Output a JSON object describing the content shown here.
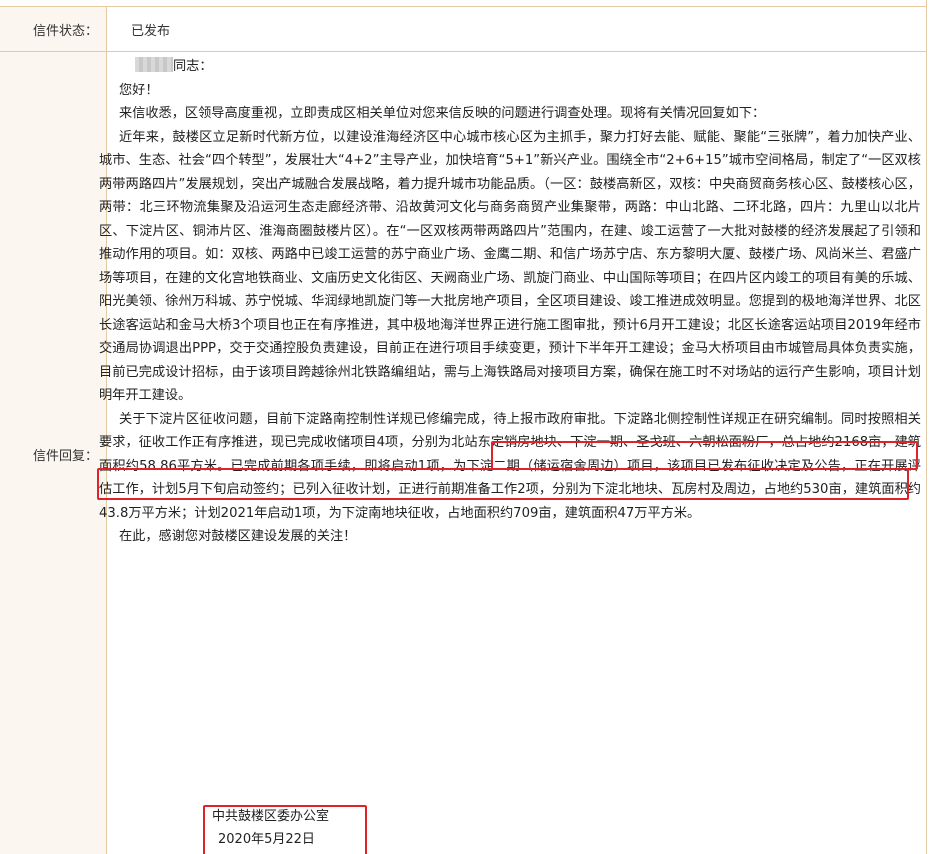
{
  "labels": {
    "status": "信件状态：",
    "reply": "信件回复："
  },
  "status_value": "已发布",
  "reply": {
    "salutation_suffix": "同志：",
    "greeting": "您好！",
    "intro": "来信收悉，区领导高度重视，立即责成区相关单位对您来信反映的问题进行调查处理。现将有关情况回复如下：",
    "para1": "近年来，鼓楼区立足新时代新方位，以建设淮海经济区中心城市核心区为主抓手，聚力打好去能、赋能、聚能“三张牌”，着力加快产业、城市、生态、社会“四个转型”，发展壮大“4+2”主导产业，加快培育“5+1”新兴产业。围绕全市“2+6+15”城市空间格局，制定了“一区双核两带两路四片”发展规划，突出产城融合发展战略，着力提升城市功能品质。（一区：鼓楼高新区，双核：中央商贸商务核心区、鼓楼核心区，两带：北三环物流集聚及沿运河生态走廊经济带、沿故黄河文化与商务商贸产业集聚带，两路：中山北路、二环北路，四片：九里山以北片区、下淀片区、铜沛片区、淮海商圈鼓楼片区）。在“一区双核两带两路四片”范围内，在建、竣工运营了一大批对鼓楼的经济发展起了引领和推动作用的项目。如：双核、两路中已竣工运营的苏宁商业广场、金鹰二期、和信广场苏宁店、东方黎明大厦、鼓楼广场、风尚米兰、君盛广场等项目，在建的文化宫地铁商业、文庙历史文化街区、天阙商业广场、凯旋门商业、中山国际等项目；在四片区内竣工的项目有美的乐城、阳光美领、徐州万科城、苏宁悦城、华润绿地凯旋门等一大批房地产项目，全区项目建设、竣工推进成效明显。您提到的极地海洋世界、北区长途客运站和金马大桥3个项目也正在有序推进，其中极地海洋世界正进行施工图审批，预计6月开工建设；北区长途客运站项目2019年经市交通局协调退出PPP，交于交通控股负责建设，目前正在进行项目手续变更，预计下半年开工建设；",
    "para1_highlight": "金马大桥项目由市城管局具体负责实施，目前已完成设计招标，由于该项目跨越徐州北铁路编组站，需与上海铁路局对接项目方案，确保在施工时不对场站的运行产生影响，项目计划明年开工建设。",
    "para2": "关于下淀片区征收问题，目前下淀路南控制性详规已修编完成，待上报市政府审批。下淀路北侧控制性详规正在研究编制。同时按照相关要求，征收工作正有序推进，现已完成收储项目4项，分别为北站东定销房地块、下淀一期、圣戈班、六朝松面粉厂，总占地约2168亩，建筑面积约58.86平方米。已完成前期各项手续，即将启动1项，为下淀二期（储运宿舍周边）项目，该项目已发布征收决定及公告，正在开展评估工作，计划5月下旬启动签约；已列入征收计划，正进行前期准备工作2项，分别为下淀北地块、瓦房村及周边，占地约530亩，建筑面积约43.8万平方米；计划2021年启动1项，为下淀南地块征收，占地面积约709亩，建筑面积47万平方米。",
    "closing": "在此，感谢您对鼓楼区建设发展的关注！",
    "signature_org": "中共鼓楼区委办公室",
    "signature_date": "2020年5月22日"
  },
  "colors": {
    "border": "#e5c9a3",
    "label_bg": "#fbf6ef",
    "highlight_box": "#e0232a"
  }
}
